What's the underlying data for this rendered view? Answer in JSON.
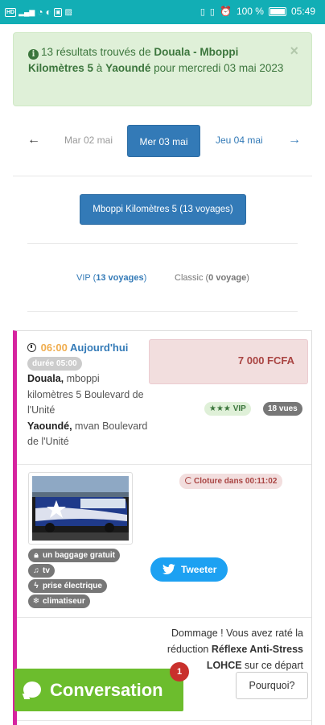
{
  "status_bar": {
    "left_icons": [
      "volte-icon",
      "4g-signal-icon",
      "signal-icon",
      "data-saver-icon",
      "app-icon",
      "gallery-icon"
    ],
    "right_icons": [
      "nfc-icon",
      "vibrate-icon",
      "alarm-icon"
    ],
    "battery": "100 %",
    "time": "05:49"
  },
  "alert": {
    "prefix": "13 résultats trouvés de ",
    "origin": "Douala - Mboppi Kilomètres 5",
    "connector": " à ",
    "destination": "Yaoundé",
    "suffix": " pour mercredi 03 mai 2023",
    "close": "×"
  },
  "date_nav": {
    "prev_arrow": "←",
    "prev_day": "Mar 02 mai",
    "active_day": "Mer 03 mai",
    "next_day": "Jeu 04 mai",
    "next_arrow": "→"
  },
  "station_button": "Mboppi Kilomètres 5 (13 voyages)",
  "class_tabs": {
    "vip_name": "VIP (",
    "vip_count": "13 voyages",
    "vip_close": ")",
    "classic_name": "Classic (",
    "classic_count": "0 voyage",
    "classic_close": ")"
  },
  "trip": {
    "time": "06:00",
    "day": "Aujourd'hui",
    "duration": "durée 05:00",
    "from_city": "Douala,",
    "from_place": " mboppi kilomètres 5 Boulevard de l'Unité",
    "to_city": "Yaoundé,",
    "to_place": " mvan Boulevard de l'Unité",
    "price": "7 000 FCFA",
    "class_badge": "VIP",
    "stars": "★★★",
    "views": "18 vues",
    "closing": "Cloture dans 00:11:02",
    "amenities": [
      "un baggage gratuit",
      "tv",
      "prise électrique",
      "climatiseur"
    ],
    "tweet": "Tweeter",
    "missed_line1": "Dommage ! Vous avez raté la réduction ",
    "missed_bold": "Réflexe Anti-Stress LOHCE",
    "missed_line2": " sur ce départ",
    "why_button": "Pourquoi?"
  },
  "chat": {
    "label": "Conversation",
    "count": "1"
  },
  "colors": {
    "status_bar": "#12aeb5",
    "primary": "#337ab7",
    "success_bg": "#dff0d8",
    "danger_bg": "#f2dede",
    "card_accent": "#d6249f",
    "chat": "#6cbd2d"
  }
}
